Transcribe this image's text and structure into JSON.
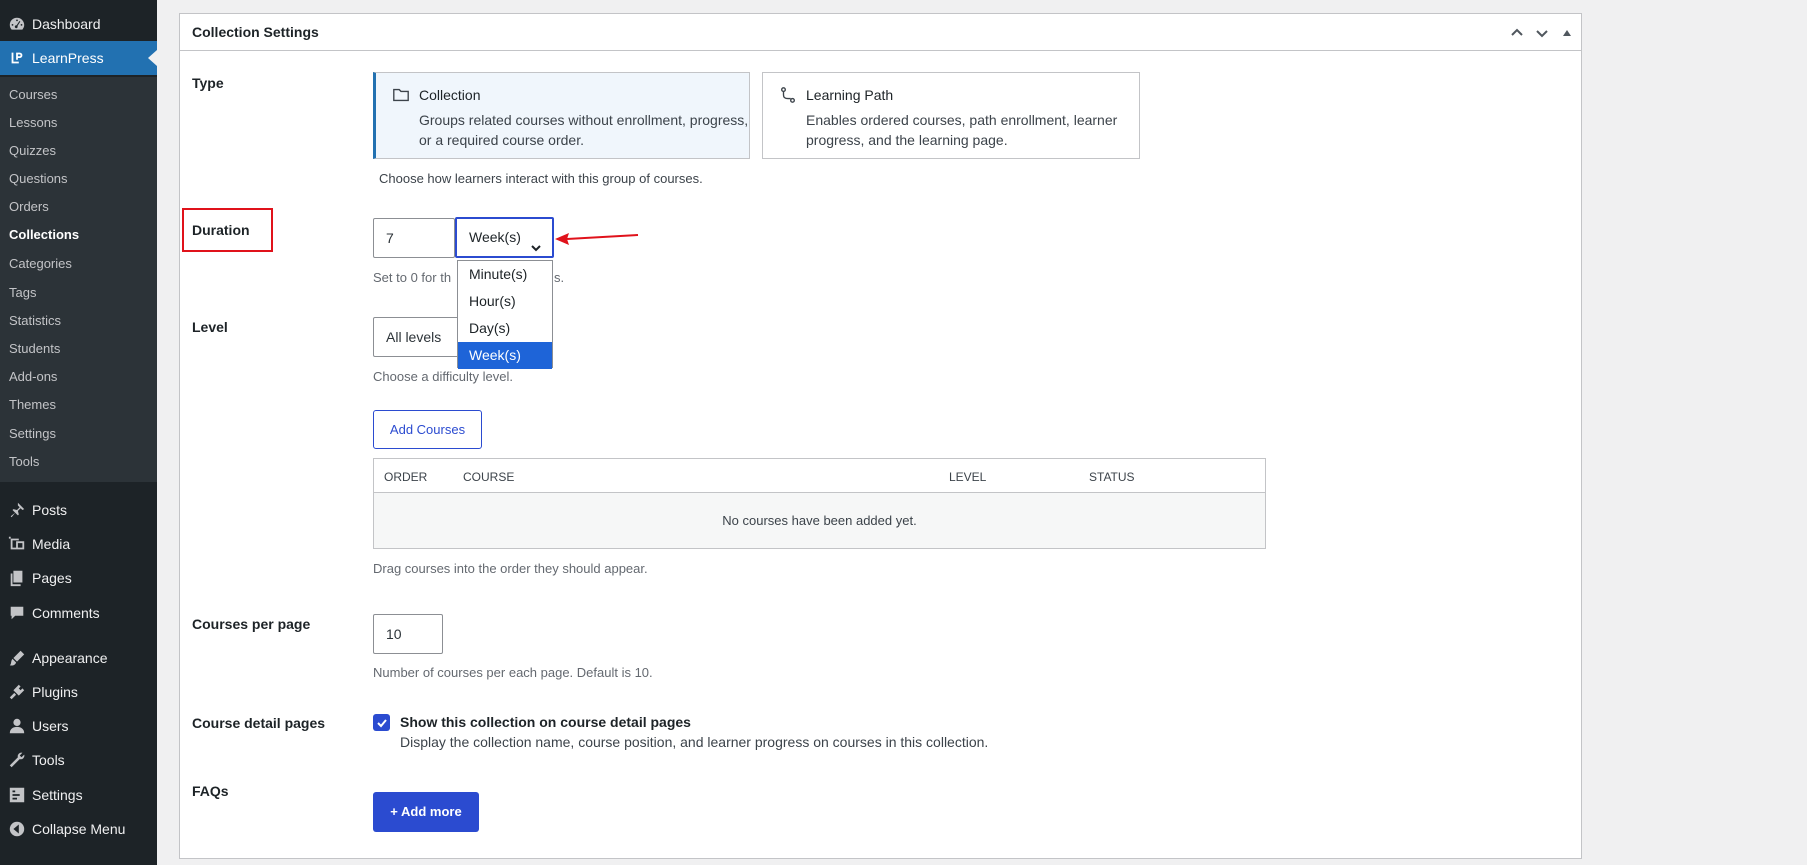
{
  "sidebar": {
    "top_items": [
      {
        "label": "Dashboard",
        "icon": "dashboard-icon"
      },
      {
        "label": "LearnPress",
        "icon": "learnpress-icon"
      }
    ],
    "submenu": [
      "Courses",
      "Lessons",
      "Quizzes",
      "Questions",
      "Orders",
      "Collections",
      "Categories",
      "Tags",
      "Statistics",
      "Students",
      "Add-ons",
      "Themes",
      "Settings",
      "Tools"
    ],
    "current_submenu": "Collections",
    "bottom_items": [
      {
        "label": "Posts",
        "icon": "pin-icon"
      },
      {
        "label": "Media",
        "icon": "media-icon"
      },
      {
        "label": "Pages",
        "icon": "pages-icon"
      },
      {
        "label": "Comments",
        "icon": "comment-icon"
      },
      {
        "label": "Appearance",
        "icon": "brush-icon"
      },
      {
        "label": "Plugins",
        "icon": "plug-icon"
      },
      {
        "label": "Users",
        "icon": "user-icon"
      },
      {
        "label": "Tools",
        "icon": "wrench-icon"
      },
      {
        "label": "Settings",
        "icon": "settings-icon"
      },
      {
        "label": "Collapse Menu",
        "icon": "collapse-icon"
      }
    ]
  },
  "panel": {
    "title": "Collection Settings",
    "type": {
      "label": "Type",
      "options": [
        {
          "title": "Collection",
          "desc": "Groups related courses without enrollment, progress, or a required course order.",
          "icon": "folder-icon",
          "selected": true
        },
        {
          "title": "Learning Path",
          "desc": "Enables ordered courses, path enrollment, learner progress, and the learning page.",
          "icon": "path-icon",
          "selected": false
        }
      ],
      "help": "Choose how learners interact with this group of courses."
    },
    "duration": {
      "label": "Duration",
      "value": "7",
      "unit": "Week(s)",
      "unit_options": [
        "Minute(s)",
        "Hour(s)",
        "Day(s)",
        "Week(s)"
      ],
      "help_start": "Set to 0 for th",
      "help_end": "s."
    },
    "level": {
      "label": "Level",
      "value": "All levels",
      "help": "Choose a difficulty level."
    },
    "courses": {
      "add_button": "Add Courses",
      "columns": [
        "ORDER",
        "COURSE",
        "LEVEL",
        "STATUS"
      ],
      "empty": "No courses have been added yet.",
      "help": "Drag courses into the order they should appear."
    },
    "per_page": {
      "label": "Courses per page",
      "value": "10",
      "help": "Number of courses per each page. Default is 10."
    },
    "detail_pages": {
      "label": "Course detail pages",
      "checkbox_label": "Show this collection on course detail pages",
      "checkbox_desc": "Display the collection name, course position, and learner progress on courses in this collection.",
      "checked": true
    },
    "faqs": {
      "label": "FAQs",
      "add_button": "+ Add more"
    }
  },
  "colors": {
    "sidebar": "#1d2327",
    "active": "#2271b1",
    "accent": "#2b4bd0",
    "highlight_red": "#e0121b"
  }
}
